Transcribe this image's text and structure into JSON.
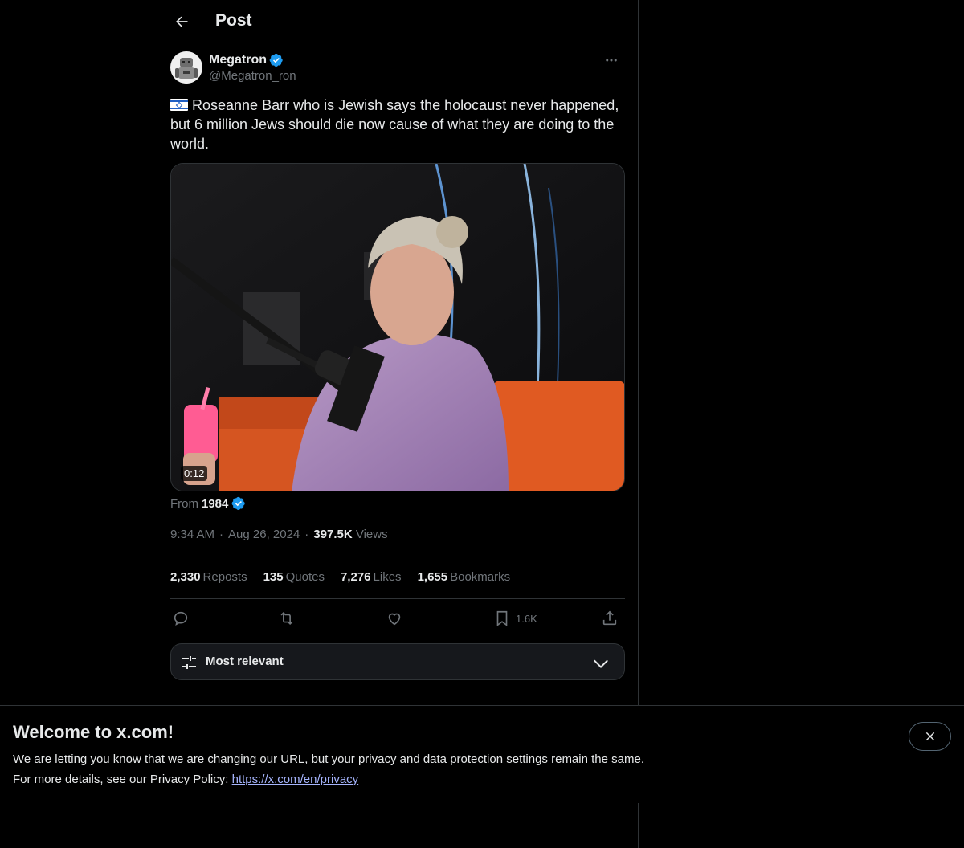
{
  "header": {
    "title": "Post"
  },
  "author": {
    "display_name": "Megatron",
    "handle": "@Megatron_ron"
  },
  "post": {
    "text": "Roseanne Barr who is Jewish says the holocaust never happened, but 6 million Jews should die now cause of what they are doing to the world.",
    "flag": "israel-flag-emoji",
    "media": {
      "duration": "0:12"
    },
    "from_label": "From",
    "from_name": "1984",
    "time": "9:34 AM",
    "date": "Aug 26, 2024",
    "separator": "·",
    "views_count": "397.5K",
    "views_label": "Views"
  },
  "stats": {
    "reposts": {
      "count": "2,330",
      "label": "Reposts"
    },
    "quotes": {
      "count": "135",
      "label": "Quotes"
    },
    "likes": {
      "count": "7,276",
      "label": "Likes"
    },
    "bookmarks": {
      "count": "1,655",
      "label": "Bookmarks"
    }
  },
  "actions": {
    "bookmark_count": "1.6K"
  },
  "sort": {
    "label": "Most relevant"
  },
  "banner": {
    "title": "Welcome to x.com!",
    "line1": "We are letting you know that we are changing our URL, but your privacy and data protection settings remain the same.",
    "line2_prefix": "For more details, see our Privacy Policy:",
    "link": "https://x.com/en/privacy"
  },
  "colors": {
    "accent": "#1d9bf0",
    "background": "#000000",
    "muted": "#71767b",
    "text": "#e7e9ea"
  }
}
